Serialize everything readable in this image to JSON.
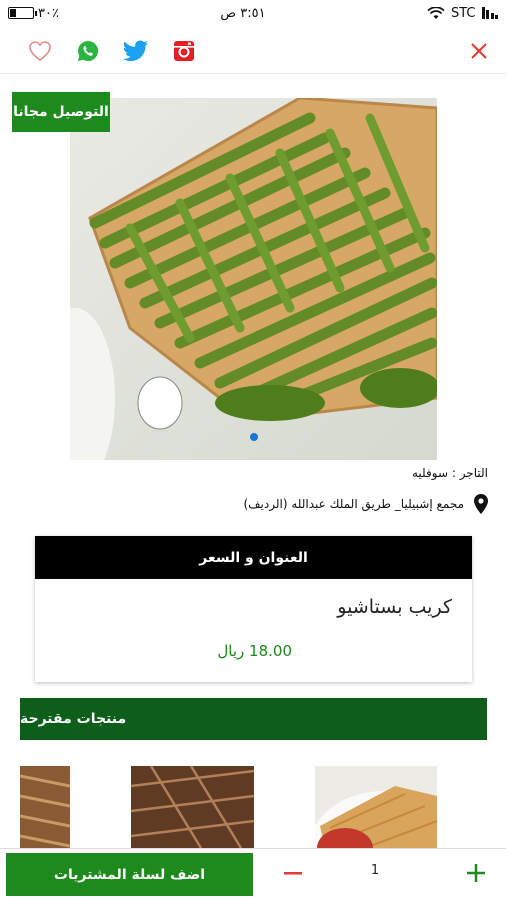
{
  "status_bar": {
    "battery_percent": "٣٠٪",
    "time": "٣:٥١ ص",
    "carrier": "STC"
  },
  "action_bar": {
    "icons": [
      "heart-icon",
      "whatsapp-icon",
      "twitter-icon",
      "instagram-icon"
    ],
    "close": "close-icon"
  },
  "product": {
    "badge": "التوصيل مجانا",
    "merchant": "التاجر : سوفليه",
    "address": "مجمع إشبيليا_ طريق الملك عبدالله (الرديف)",
    "card_header": "العنوان و السعر",
    "title": "كريب بستاشيو",
    "price": "18.00 ريال"
  },
  "suggested": {
    "title": "منتجات مقترحة"
  },
  "cart": {
    "add_label": "اضف لسلة المشتريات",
    "quantity": "1"
  },
  "colors": {
    "accent_green": "#1e8a1e",
    "dark_green": "#0d5e1b",
    "close_red": "#e53935"
  }
}
